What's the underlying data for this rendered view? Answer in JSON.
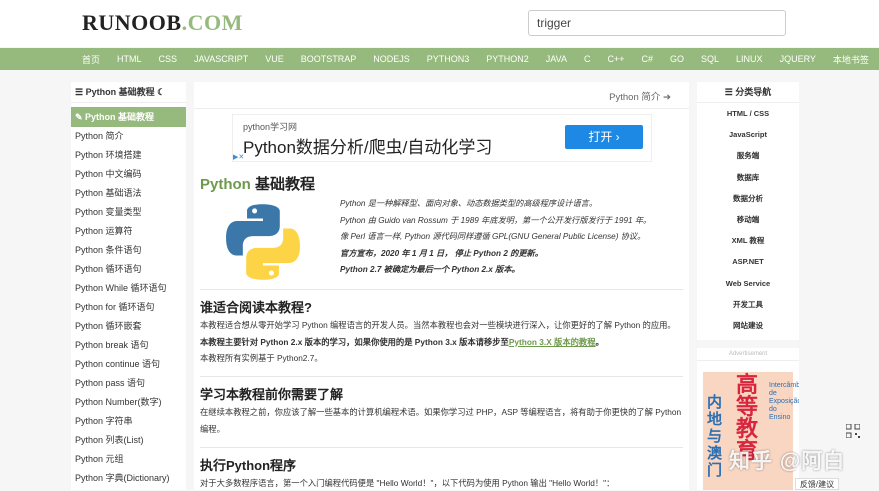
{
  "header": {
    "logo_main": "RUNOOB",
    "logo_suffix": ".COM",
    "search_value": "trigger"
  },
  "nav": [
    "首页",
    "HTML",
    "CSS",
    "JAVASCRIPT",
    "VUE",
    "BOOTSTRAP",
    "NODEJS",
    "PYTHON3",
    "PYTHON2",
    "JAVA",
    "C",
    "C++",
    "C#",
    "GO",
    "SQL",
    "LINUX",
    "JQUERY",
    "本地书签"
  ],
  "sidebar": {
    "title": "Python 基础教程",
    "active": "Python 基础教程",
    "items": [
      "Python 简介",
      "Python 环境搭建",
      "Python 中文编码",
      "Python 基础语法",
      "Python 变量类型",
      "Python 运算符",
      "Python 条件语句",
      "Python 循环语句",
      "Python While 循环语句",
      "Python for 循环语句",
      "Python 循环嵌套",
      "Python break 语句",
      "Python continue 语句",
      "Python pass 语句",
      "Python Number(数字)",
      "Python 字符串",
      "Python 列表(List)",
      "Python 元组",
      "Python 字典(Dictionary)"
    ]
  },
  "content": {
    "prev_link": "Python 简介",
    "ad": {
      "small": "python学习网",
      "big": "Python数据分析/爬虫/自动化学习",
      "button": "打开"
    },
    "title_green": "Python",
    "title_rest": " 基础教程",
    "intro": [
      "Python 是一种解释型、面向对象、动态数据类型的高级程序设计语言。",
      "Python 由 Guido van Rossum 于 1989 年底发明，第一个公开发行版发行于 1991 年。",
      "像 Perl 语言一样, Python 源代码同样遵循 GPL(GNU General Public License) 协议。",
      "官方宣布，2020 年 1 月 1 日， 停止 Python 2 的更新。",
      "Python 2.7 被确定为最后一个 Python 2.x 版本。"
    ],
    "section1": {
      "heading": "谁适合阅读本教程?",
      "p1": "本教程适合想从零开始学习 Python 编程语言的开发人员。当然本教程也会对一些模块进行深入，让你更好的了解 Python 的应用。",
      "p2_bold": "本教程主要针对 Python 2.x 版本的学习，如果你使用的是 Python 3.x 版本请移步至",
      "p2_link": "Python 3.X 版本的教程",
      "p2_end": "。",
      "p3": "本教程所有实例基于 Python2.7。"
    },
    "section2": {
      "heading": "学习本教程前你需要了解",
      "p1": "在继续本教程之前，你应该了解一些基本的计算机编程术语。如果你学习过 PHP，ASP 等编程语言，将有助于你更快的了解 Python 编程。"
    },
    "section3": {
      "heading": "执行Python程序",
      "p1": "对于大多数程序语言，第一个入门编程代码便是 \"Hello World！\"，以下代码为使用 Python 输出 \"Hello World！\"："
    }
  },
  "rightnav": {
    "title": "分类导航",
    "items": [
      "HTML / CSS",
      "JavaScript",
      "服务端",
      "数据库",
      "数据分析",
      "移动端",
      "XML 教程",
      "ASP.NET",
      "Web Service",
      "开发工具",
      "网站建设"
    ]
  },
  "rightad": {
    "label": "Advertisement",
    "poster_left": "内地与澳门",
    "poster_big": "高等教育",
    "poster_side": "Intercâmbio de Exposição do Ensino"
  },
  "feedback": "反馈/建议",
  "watermark": "知乎 @阿白"
}
